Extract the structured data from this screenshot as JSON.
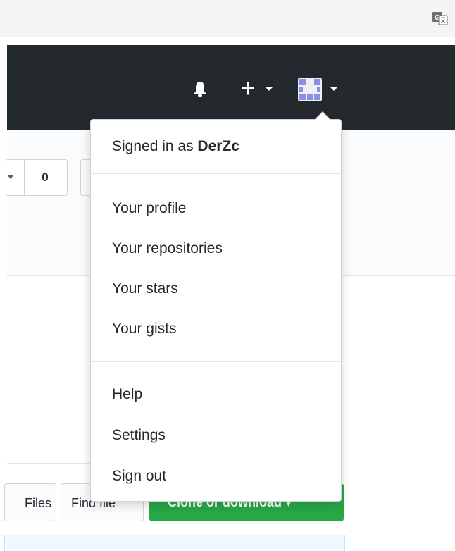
{
  "browser": {
    "translate_icon": "google-translate-icon"
  },
  "header": {
    "background": "#24292e",
    "icons": {
      "notifications": "bell-icon",
      "create": "plus-icon",
      "avatar": "identicon-avatar"
    },
    "avatar_color": "#8b8fe8"
  },
  "repo": {
    "counter_value": "0"
  },
  "file_nav": {
    "files_label": "Files",
    "find_file_label": "Find file",
    "clone_label": "Clone or download ▾",
    "clone_color": "#28a745"
  },
  "user_menu": {
    "signed_in_prefix": "Signed in as ",
    "username": "DerZc",
    "group1": [
      "Your profile",
      "Your repositories",
      "Your stars",
      "Your gists"
    ],
    "group2": [
      "Help",
      "Settings",
      "Sign out"
    ]
  }
}
